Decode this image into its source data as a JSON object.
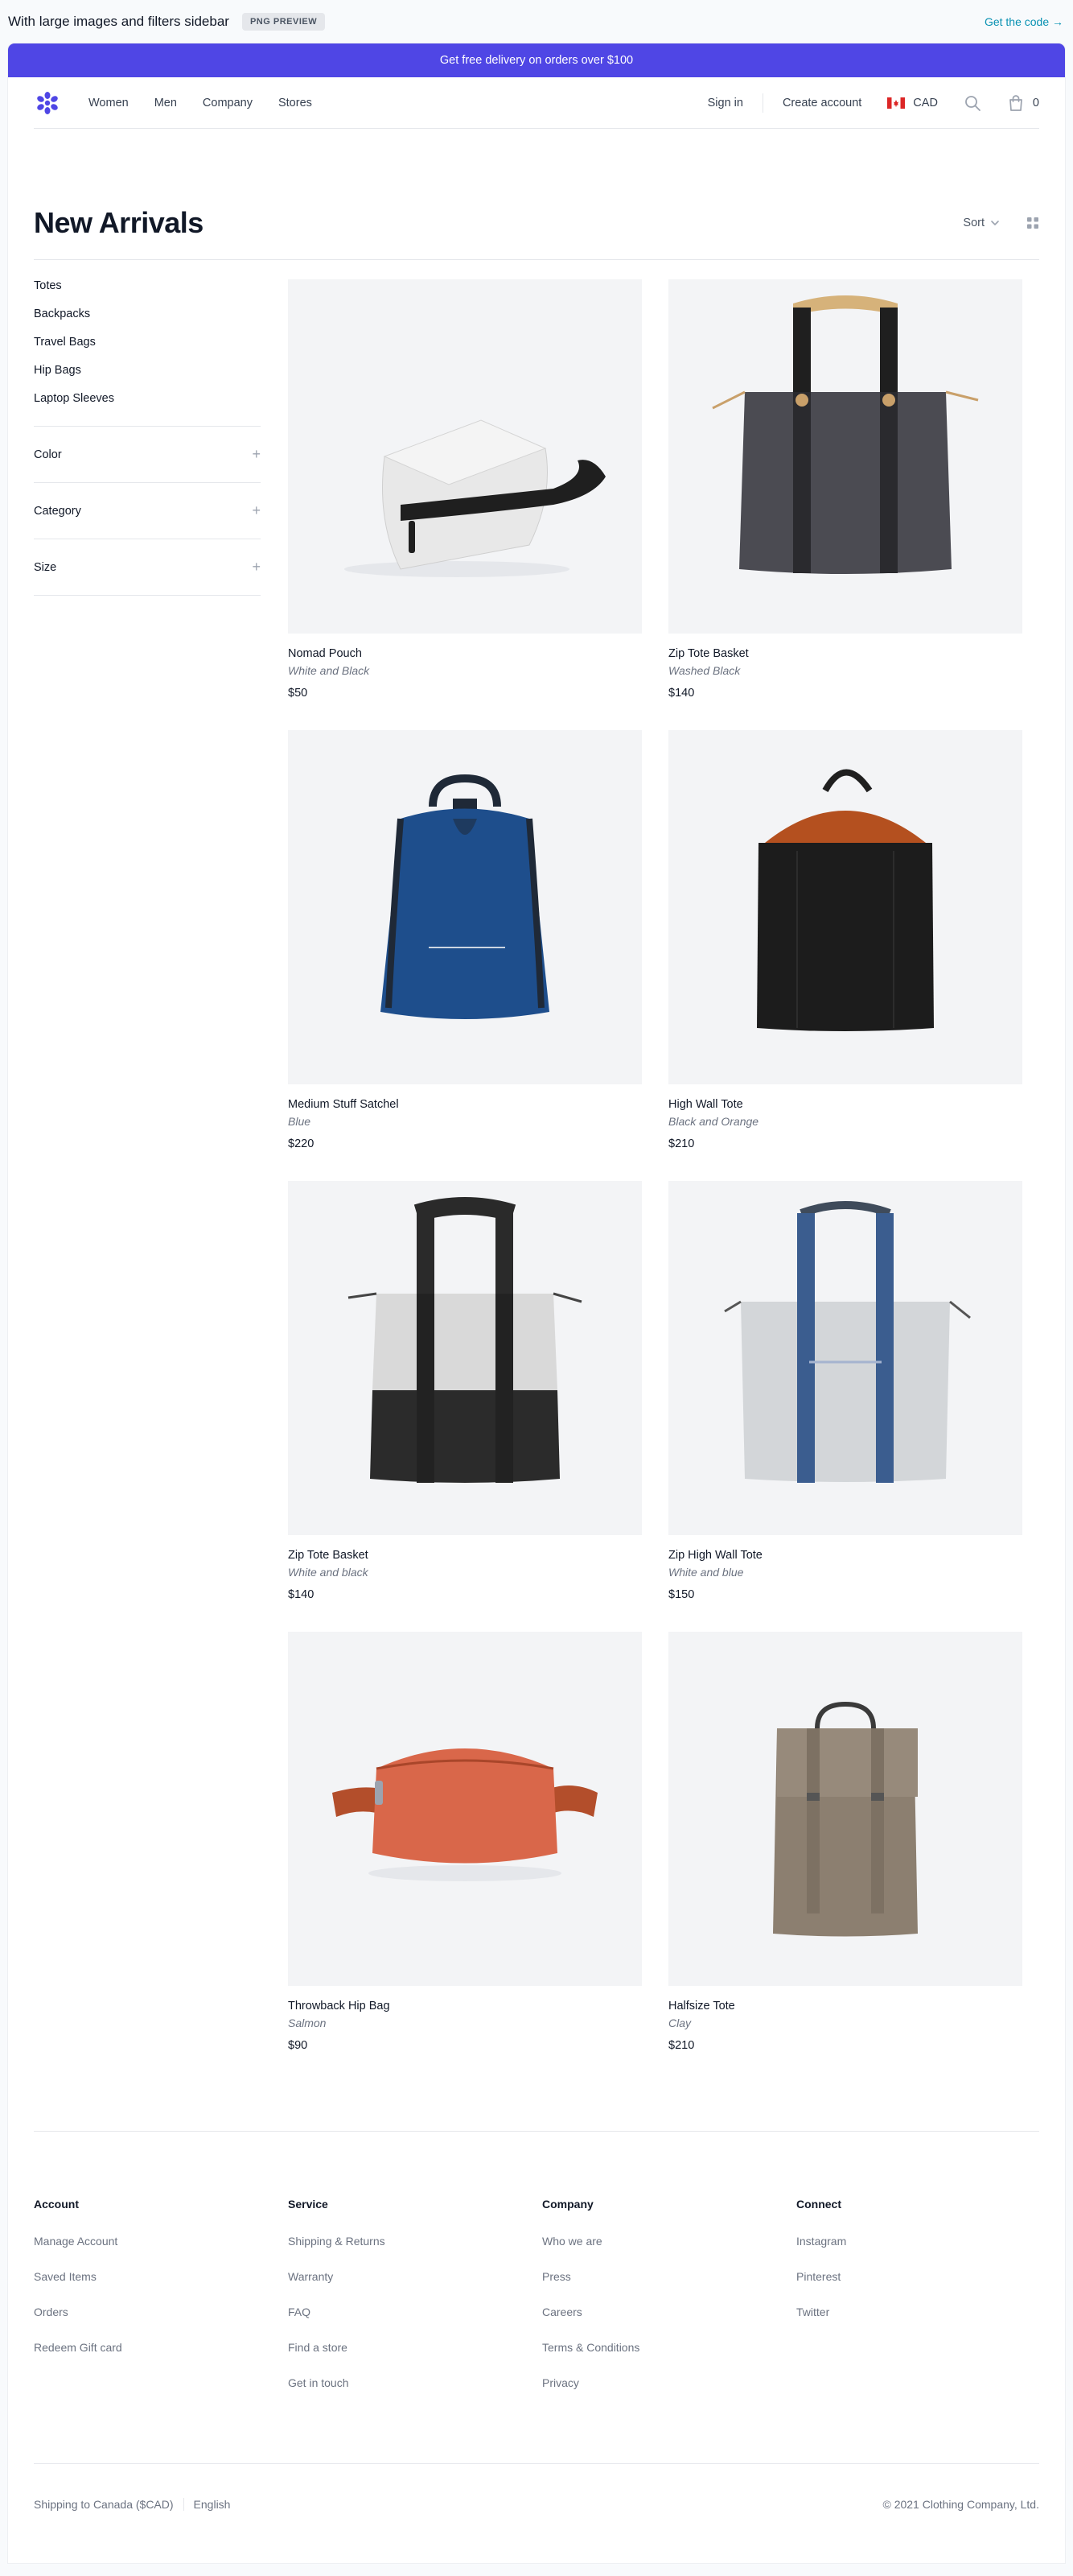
{
  "preview": {
    "title": "With large images and filters sidebar",
    "badge": "PNG PREVIEW",
    "get_code": "Get the code →"
  },
  "promo": "Get free delivery on orders over $100",
  "nav": {
    "links": [
      "Women",
      "Men",
      "Company",
      "Stores"
    ],
    "sign_in": "Sign in",
    "create_account": "Create account",
    "currency": "CAD",
    "cart_count": "0"
  },
  "page": {
    "title": "New Arrivals",
    "sort_label": "Sort"
  },
  "sidebar": {
    "categories": [
      "Totes",
      "Backpacks",
      "Travel Bags",
      "Hip Bags",
      "Laptop Sleeves"
    ],
    "filters": [
      "Color",
      "Category",
      "Size"
    ]
  },
  "products": [
    {
      "name": "Nomad Pouch",
      "color": "White and Black",
      "price": "$50"
    },
    {
      "name": "Zip Tote Basket",
      "color": "Washed Black",
      "price": "$140"
    },
    {
      "name": "Medium Stuff Satchel",
      "color": "Blue",
      "price": "$220"
    },
    {
      "name": "High Wall Tote",
      "color": "Black and Orange",
      "price": "$210"
    },
    {
      "name": "Zip Tote Basket",
      "color": "White and black",
      "price": "$140"
    },
    {
      "name": "Zip High Wall Tote",
      "color": "White and blue",
      "price": "$150"
    },
    {
      "name": "Throwback Hip Bag",
      "color": "Salmon",
      "price": "$90"
    },
    {
      "name": "Halfsize Tote",
      "color": "Clay",
      "price": "$210"
    }
  ],
  "footer": {
    "columns": [
      {
        "title": "Account",
        "links": [
          "Manage Account",
          "Saved Items",
          "Orders",
          "Redeem Gift card"
        ]
      },
      {
        "title": "Service",
        "links": [
          "Shipping & Returns",
          "Warranty",
          "FAQ",
          "Find a store",
          "Get in touch"
        ]
      },
      {
        "title": "Company",
        "links": [
          "Who we are",
          "Press",
          "Careers",
          "Terms & Conditions",
          "Privacy"
        ]
      },
      {
        "title": "Connect",
        "links": [
          "Instagram",
          "Pinterest",
          "Twitter"
        ]
      }
    ],
    "shipping": "Shipping to Canada ($CAD)",
    "language": "English",
    "copyright": "© 2021 Clothing Company, Ltd."
  },
  "colors": {
    "accent": "#4f46e5",
    "link_teal": "#0891b2",
    "image_bg": "#f3f4f6"
  }
}
